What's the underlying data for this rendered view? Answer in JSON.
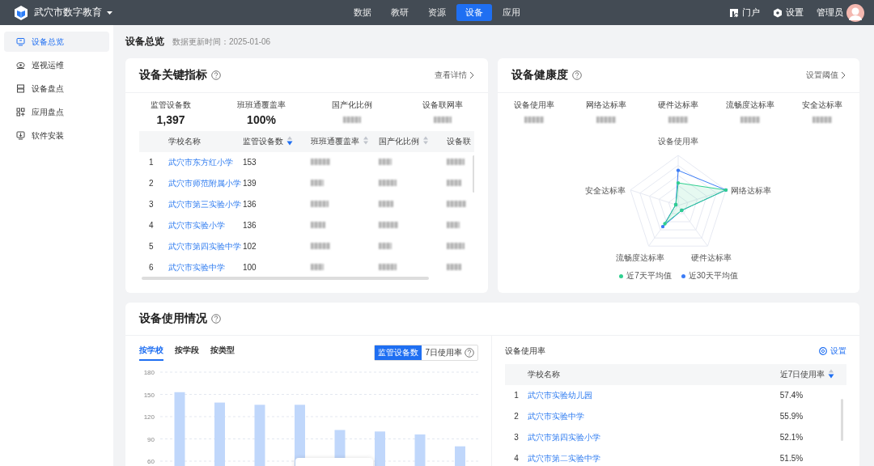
{
  "topbar": {
    "app_name": "武穴市数字教育",
    "nav": [
      {
        "label": "数据",
        "selected": false
      },
      {
        "label": "教研",
        "selected": false
      },
      {
        "label": "资源",
        "selected": false
      },
      {
        "label": "设备",
        "selected": true
      },
      {
        "label": "应用",
        "selected": false
      }
    ],
    "actions": [
      {
        "label": "门户",
        "kind": "portal"
      },
      {
        "label": "设置",
        "kind": "settings"
      }
    ],
    "user": "管理员"
  },
  "sidebar": {
    "items": [
      {
        "label": "设备总览",
        "kind": "monitor",
        "selected": true
      },
      {
        "label": "巡视运维",
        "kind": "eye",
        "selected": false
      },
      {
        "label": "设备盘点",
        "kind": "server",
        "selected": false
      },
      {
        "label": "应用盘点",
        "kind": "apps",
        "selected": false
      },
      {
        "label": "软件安装",
        "kind": "install",
        "selected": false
      }
    ]
  },
  "page": {
    "title": "设备总览",
    "updated": "数据更新时间：2025-01-06"
  },
  "key_metrics": {
    "title": "设备关键指标",
    "link": "查看详情",
    "stats": [
      {
        "label": "监管设备数",
        "value": "1,397"
      },
      {
        "label": "班班通覆盖率",
        "value": "100%"
      },
      {
        "label": "国产化比例",
        "blurred": true
      },
      {
        "label": "设备联网率",
        "blurred": true
      }
    ],
    "table": {
      "columns": [
        {
          "label": "学校名称",
          "kind": "link"
        },
        {
          "label": "监管设备数",
          "kind": "text",
          "sortable": true,
          "sorted": true
        },
        {
          "label": "班班通覆盖率",
          "kind": "blurred",
          "sortable": true,
          "sorted": false
        },
        {
          "label": "国产化比例",
          "kind": "blurred",
          "sortable": true,
          "sorted": false
        },
        {
          "label": "设备联",
          "kind": "blurred"
        }
      ],
      "rows": [
        {
          "index": "1",
          "school": "武穴市东方红小学",
          "devices": "153"
        },
        {
          "index": "2",
          "school": "武穴市师范附属小学",
          "devices": "139"
        },
        {
          "index": "3",
          "school": "武穴市第三实验小学",
          "devices": "136"
        },
        {
          "index": "4",
          "school": "武穴市实验小学",
          "devices": "136"
        },
        {
          "index": "5",
          "school": "武穴市第四实验中学",
          "devices": "102"
        },
        {
          "index": "6",
          "school": "武穴市实验中学",
          "devices": "100"
        }
      ]
    }
  },
  "health": {
    "title": "设备健康度",
    "link": "设置阈值",
    "metrics": [
      {
        "label": "设备使用率",
        "blurred": true
      },
      {
        "label": "网络达标率",
        "blurred": true
      },
      {
        "label": "硬件达标率",
        "blurred": true
      },
      {
        "label": "流畅度达标率",
        "blurred": true
      },
      {
        "label": "安全达标率",
        "blurred": true
      }
    ],
    "radar": {
      "axes": [
        "设备使用率",
        "网络达标率",
        "硬件达标率",
        "流畅度达标率",
        "安全达标率"
      ],
      "legend": [
        {
          "label": "近7天平均值",
          "color": "#2fcf8f"
        },
        {
          "label": "近30天平均值",
          "color": "#3b7cf6"
        }
      ]
    }
  },
  "usage": {
    "title": "设备使用情况",
    "tabs": [
      {
        "label": "按学校",
        "selected": true
      },
      {
        "label": "按学段",
        "selected": false
      },
      {
        "label": "按类型",
        "selected": false
      }
    ],
    "toggle": [
      {
        "label": "监管设备数",
        "selected": true
      },
      {
        "label": "7日使用率",
        "selected": false
      }
    ],
    "chart_data": {
      "type": "bar",
      "values": [
        153,
        139,
        136,
        136,
        102,
        100,
        96,
        80
      ],
      "ylim": [
        60,
        180
      ],
      "yticks": [
        60,
        90,
        120,
        150,
        180
      ],
      "grid": true
    },
    "ranking": {
      "title": "设备使用率",
      "action": "设置",
      "columns": [
        {
          "label": "学校名称"
        },
        {
          "label": "近7日使用率",
          "sortable": true,
          "sorted": true
        }
      ],
      "rows": [
        {
          "index": "1",
          "school": "武穴市实验幼儿园",
          "rate": "57.4%"
        },
        {
          "index": "2",
          "school": "武穴市实验中学",
          "rate": "55.9%"
        },
        {
          "index": "3",
          "school": "武穴市第四实验小学",
          "rate": "52.1%"
        },
        {
          "index": "4",
          "school": "武穴市第二实验中学",
          "rate": "51.5%"
        }
      ]
    }
  }
}
